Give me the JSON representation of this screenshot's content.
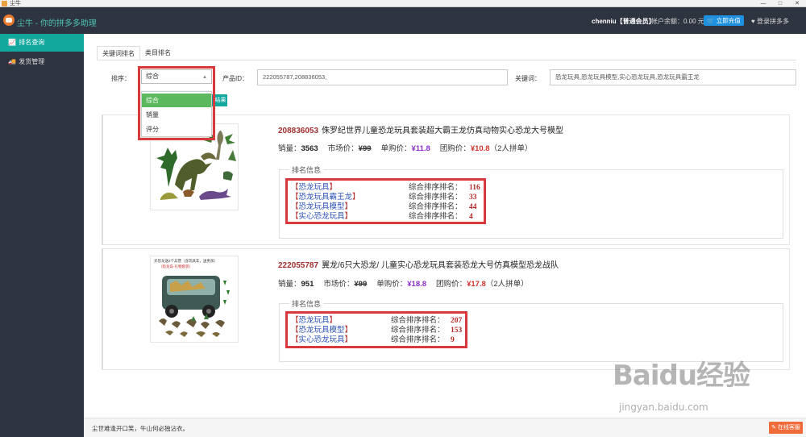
{
  "window": {
    "title": "尘牛",
    "controls": [
      "—",
      "□",
      "✕"
    ]
  },
  "header": {
    "app_title": "尘牛 - 你的拼多多助理",
    "user": "chenniu【普通会员】",
    "balance": "帐户余额：0.00 元",
    "recharge_label": "立即充值",
    "login_pdd_label": "登录拼多多"
  },
  "sidebar": {
    "items": [
      {
        "label": "排名查询",
        "icon": "chart-icon"
      },
      {
        "label": "发货管理",
        "icon": "truck-icon"
      }
    ]
  },
  "tabs": [
    {
      "label": "关键词排名"
    },
    {
      "label": "类目排名"
    }
  ],
  "filters": {
    "sort_label": "排序：",
    "sort_value": "综合",
    "sort_options": [
      "综合",
      "销量",
      "评分"
    ],
    "product_id_label": "产品ID：",
    "product_id_value": "222055787,208836053,",
    "keyword_label": "关键词：",
    "keyword_value": "恐龙玩具,恐龙玩具模型,实心恐龙玩具,恐龙玩具霸王龙",
    "query_button_partial": "结果"
  },
  "products": [
    {
      "id": "208836053",
      "title": "侏罗纪世界儿童恐龙玩具套装超大霸王龙仿真动物实心恐龙大号模型",
      "sales_label": "销量：",
      "sales": "3563",
      "market_label": "市场价：",
      "market_price": "¥99",
      "single_label": "单购价：",
      "single_price": "¥11.8",
      "group_label": "团购价：",
      "group_price": "¥10.8",
      "group_note": "（2人拼单）",
      "rank_legend": "排名信息",
      "rankings": [
        {
          "keyword": "恐龙玩具",
          "label": "综合排序排名：",
          "rank": "116"
        },
        {
          "keyword": "恐龙玩具霸王龙",
          "label": "综合排序排名：",
          "rank": "33"
        },
        {
          "keyword": "恐龙玩具模型",
          "label": "综合排序排名：",
          "rank": "44"
        },
        {
          "keyword": "实心恐龙玩具",
          "label": "综合排序排名：",
          "rank": "4"
        }
      ]
    },
    {
      "id": "222055787",
      "title": "翼龙/6只大恐龙/ 儿童实心恐龙玩具套装恐龙大号仿真模型恐龙战队",
      "sales_label": "销量：",
      "sales": "951",
      "market_label": "市场价：",
      "market_price": "¥99",
      "single_label": "单购价：",
      "single_price": "¥18.8",
      "group_label": "团购价：",
      "group_price": "¥17.8",
      "group_note": "（2人拼单）",
      "rank_legend": "排名信息",
      "rankings": [
        {
          "keyword": "恐龙玩具",
          "label": "综合排序排名：",
          "rank": "207"
        },
        {
          "keyword": "恐龙玩具模型",
          "label": "综合排序排名：",
          "rank": "153"
        },
        {
          "keyword": "实心恐龙玩具",
          "label": "综合排序排名：",
          "rank": "9"
        }
      ]
    }
  ],
  "thumb2_caption": "买恐龙送2个兵营（含玩具车，送男孩）",
  "thumb2_subcaption": "（恐龙岛·礼物套装）",
  "footer": {
    "text": "尘世难逢开口笑，牛山何必独沾衣。",
    "feedback_label": "在线客服"
  },
  "watermark": {
    "brand": "Baidu经验",
    "url": "jingyan.baidu.com"
  },
  "colors": {
    "accent": "#13a89e",
    "header_bg": "#2e3340",
    "highlight_box": "#d9383d",
    "price_purple": "#8b2fc8",
    "price_red": "#d0342c"
  }
}
